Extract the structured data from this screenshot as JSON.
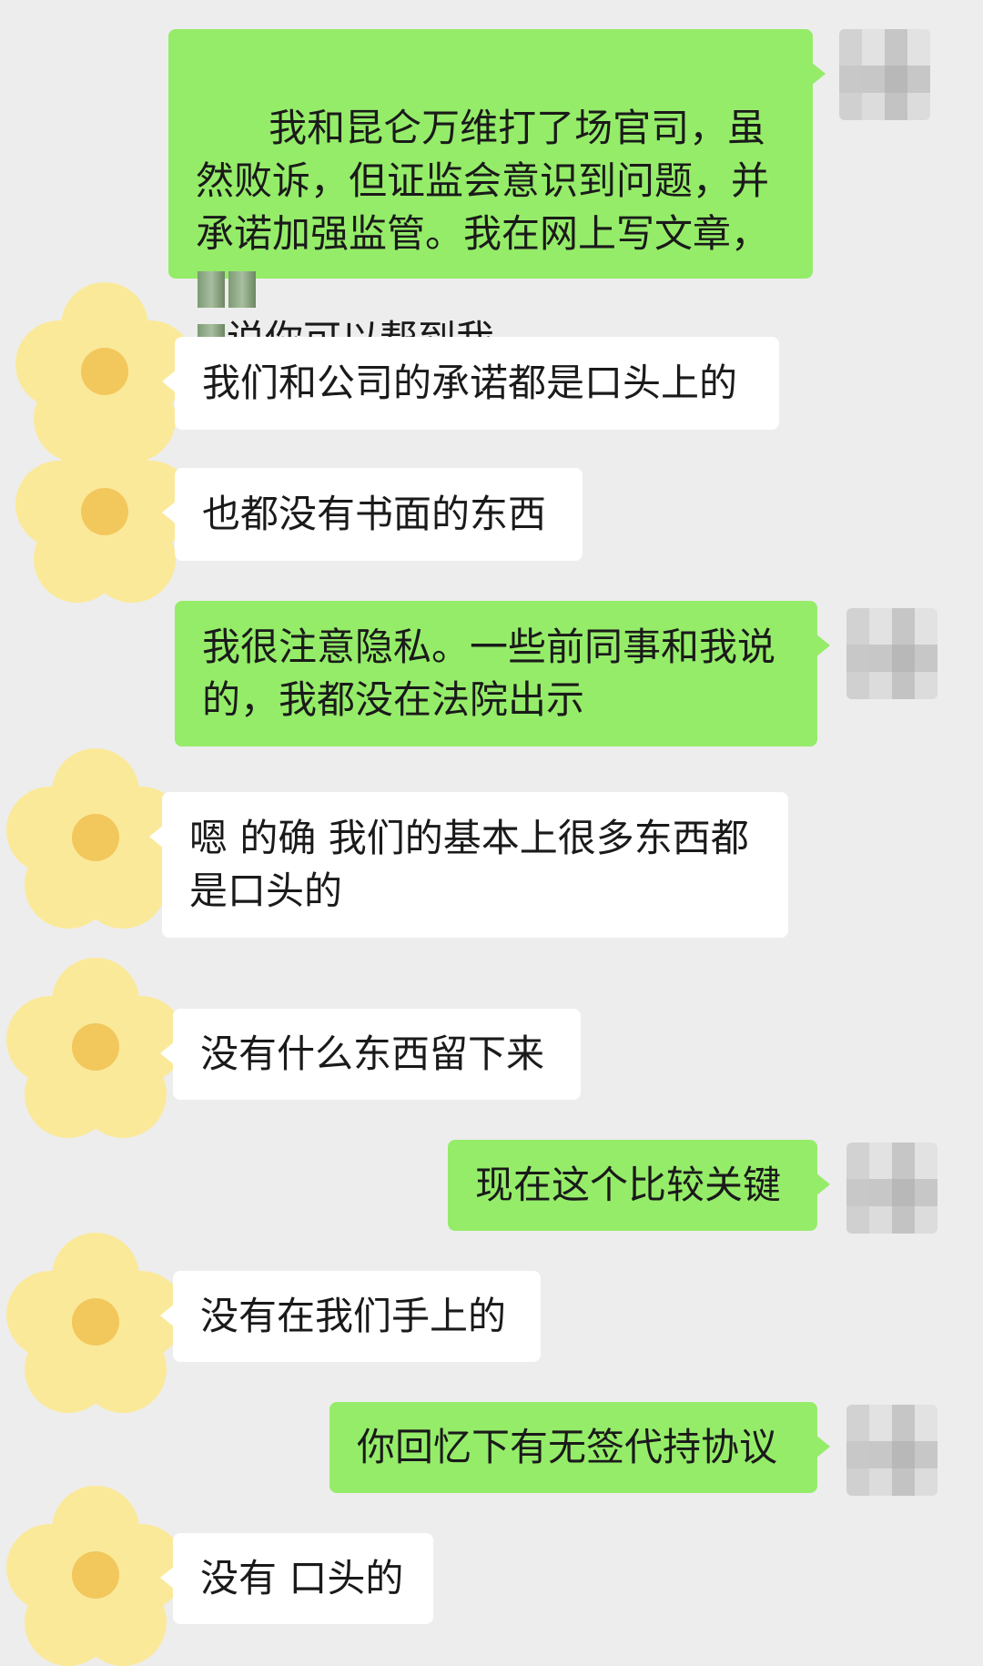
{
  "conversation": {
    "messages": [
      {
        "side": "out",
        "text": "我和昆仑万维打了场官司，虽然败诉，但证监会意识到问题，并承诺加强监管。我在网上写文章，",
        "text_after_redaction": "说你可以帮到我"
      },
      {
        "side": "in",
        "text": "我们和公司的承诺都是口头上的"
      },
      {
        "side": "in",
        "text": "也都没有书面的东西"
      },
      {
        "side": "out",
        "text": "我很注意隐私。一些前同事和我说的，我都没在法院出示"
      },
      {
        "side": "in",
        "text": "嗯 的确 我们的基本上很多东西都是口头的"
      },
      {
        "side": "in",
        "text": "没有什么东西留下来"
      },
      {
        "side": "out",
        "text": "现在这个比较关键"
      },
      {
        "side": "in",
        "text": "没有在我们手上的"
      },
      {
        "side": "out",
        "text": "你回忆下有无签代持协议"
      },
      {
        "side": "in",
        "text": "没有 口头的"
      }
    ]
  },
  "colors": {
    "background": "#ededed",
    "outgoing_bubble": "#95ec69",
    "incoming_bubble": "#ffffff",
    "flower_petal": "#fbe99a",
    "flower_center": "#f2c75c"
  },
  "icons": {
    "incoming_avatar": "flower-icon",
    "outgoing_avatar": "pixelated-avatar"
  }
}
